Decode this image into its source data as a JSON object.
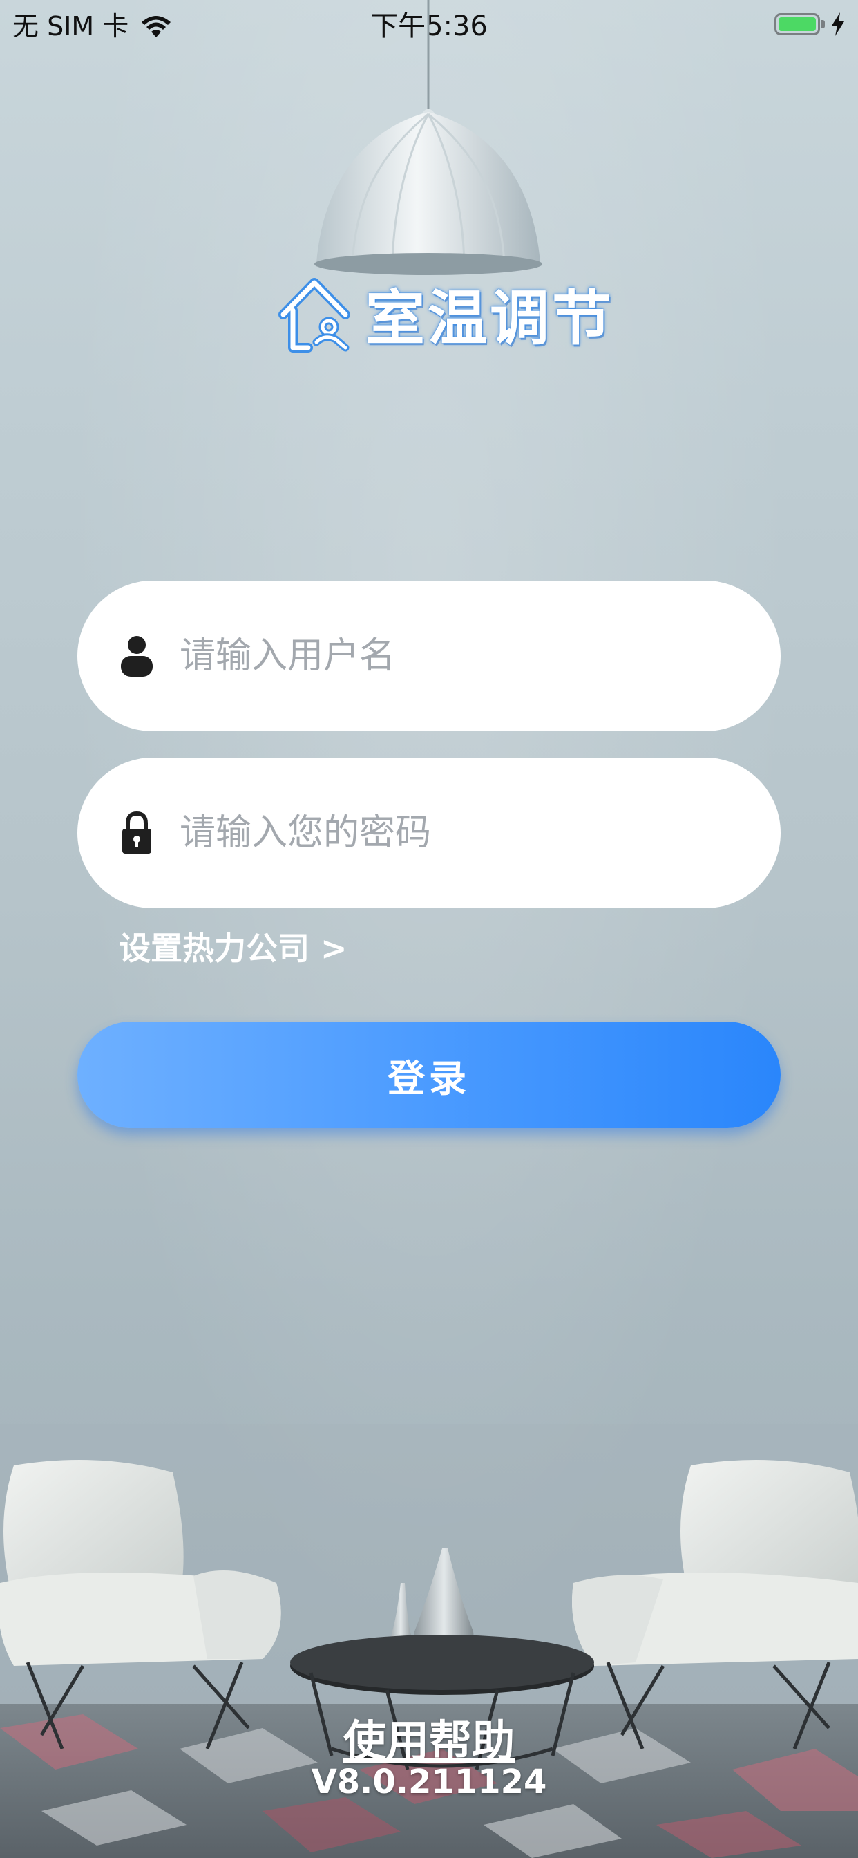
{
  "status_bar": {
    "carrier": "无 SIM 卡",
    "time": "下午5:36",
    "battery_color": "#4cd964"
  },
  "app": {
    "title": "室温调节",
    "logo_icon": "house-thermometer-icon"
  },
  "login_form": {
    "username": {
      "placeholder": "请输入用户名",
      "value": "",
      "icon": "user-icon"
    },
    "password": {
      "placeholder": "请输入您的密码",
      "value": "",
      "icon": "lock-icon"
    },
    "company_link": "设置热力公司 >",
    "login_button": "登录"
  },
  "footer": {
    "help_link": "使用帮助",
    "version": "V8.0.211124"
  },
  "colors": {
    "accent": "#3b8ff8",
    "button_gradient_start": "#6eb0ff",
    "button_gradient_end": "#2a86fb"
  }
}
